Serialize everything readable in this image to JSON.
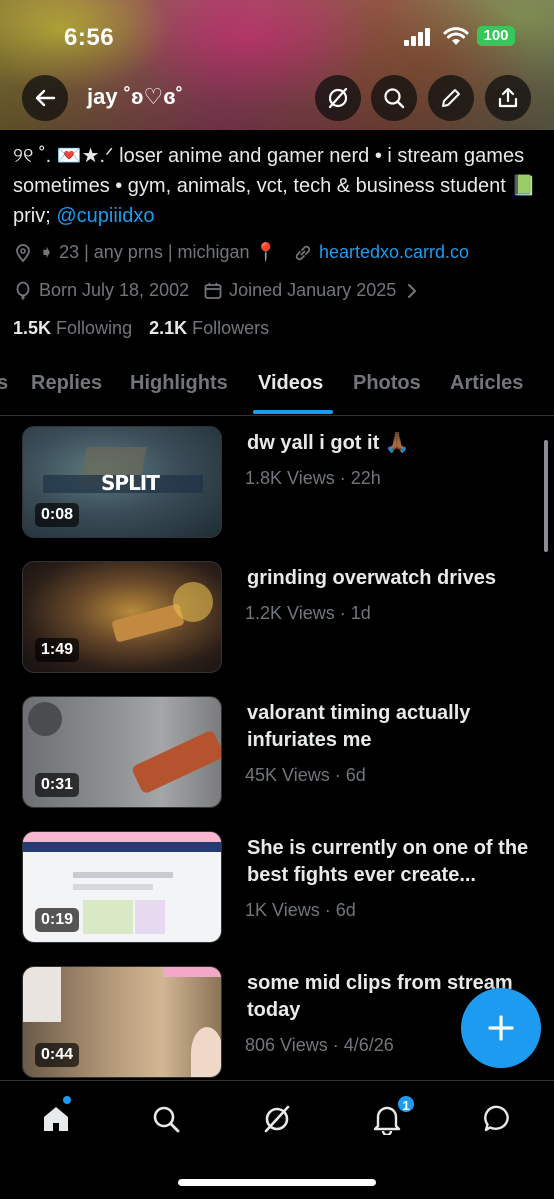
{
  "status_bar": {
    "time": "6:56",
    "battery": "100"
  },
  "header": {
    "profile_name": "jay ˚ʚ♡ɞ˚"
  },
  "bio": {
    "text": "୨୧ ˚. 💌★.ᐟ loser anime and gamer nerd • i stream games sometimes • gym, animals, vct, tech & business student 📗 priv; ",
    "handle": "@cupiiidxo"
  },
  "meta": {
    "location": "➧ 23 | any prns | michigan 📍",
    "website": "heartedxo.carrd.co",
    "born": "Born July 18, 2002",
    "joined": "Joined January 2025"
  },
  "counts": {
    "following_count": "1.5K",
    "following_label": "Following",
    "followers_count": "2.1K",
    "followers_label": "Followers"
  },
  "tabs": [
    {
      "label": "s"
    },
    {
      "label": "Replies"
    },
    {
      "label": "Highlights"
    },
    {
      "label": "Videos"
    },
    {
      "label": "Photos"
    },
    {
      "label": "Articles"
    }
  ],
  "active_tab": "Videos",
  "videos": [
    {
      "title": "dw yall i got it 🙏🏾",
      "meta": "1.8K Views · 22h",
      "duration": "0:08",
      "thumb_text": "SPLIT"
    },
    {
      "title": "grinding overwatch drives",
      "meta": "1.2K Views · 1d",
      "duration": "1:49"
    },
    {
      "title": "valorant timing actually infuriates me",
      "meta": "45K Views · 6d",
      "duration": "0:31"
    },
    {
      "title": "She is currently on one of the best fights ever create...",
      "meta": "1K Views · 6d",
      "duration": "0:19"
    },
    {
      "title": "some mid clips from stream today",
      "meta": "806 Views · 4/6/26",
      "duration": "0:44"
    }
  ],
  "nav": {
    "notifications_badge": "1"
  },
  "colors": {
    "accent": "#1d9bf0",
    "muted": "#71767b",
    "text": "#e7e9ea",
    "battery": "#34c759"
  }
}
